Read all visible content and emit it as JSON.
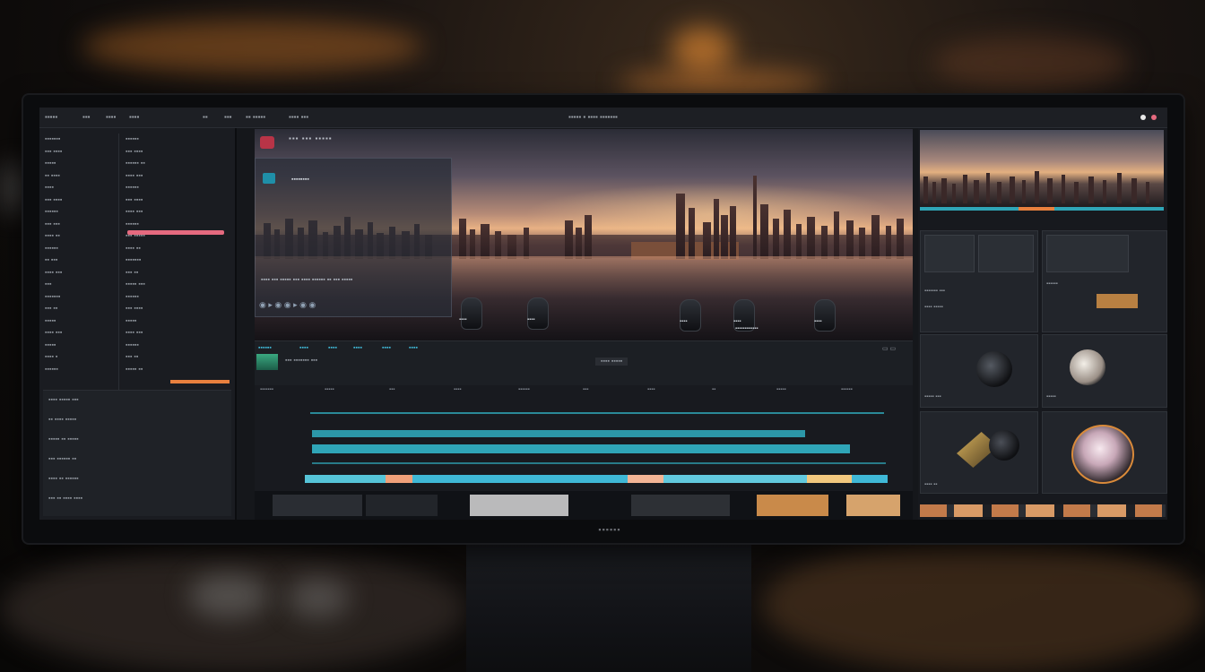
{
  "screen": {
    "menubar": {
      "left_items": [
        "▪▪▪▪▪",
        "▪▪▪",
        "▪▪▪▪",
        "▪▪▪▪",
        "▪▪",
        "▪▪▪",
        "▪▪ ▪▪▪▪▪",
        "▪▪▪▪ ▪▪▪"
      ],
      "center_text": "▪▪▪▪▪ ▪ ▪▪▪▪ ▪▪▪▪▪▪▪"
    },
    "brand": "▪▪▪▪▪▪"
  },
  "left_panel": {
    "col_a": [
      "▪▪▪▪▪▪▪",
      "▪▪▪ ▪▪▪▪",
      "▪▪▪▪▪",
      "▪▪ ▪▪▪▪",
      "▪▪▪▪",
      "▪▪▪ ▪▪▪▪",
      "▪▪▪▪▪▪",
      "▪▪▪ ▪▪▪",
      "▪▪▪▪ ▪▪",
      "▪▪▪▪▪▪",
      "▪▪ ▪▪▪",
      "▪▪▪▪ ▪▪▪",
      "▪▪▪",
      "▪▪▪▪▪▪▪",
      "▪▪▪ ▪▪",
      "▪▪▪▪▪",
      "▪▪▪▪ ▪▪▪",
      "▪▪▪▪▪",
      "▪▪▪▪ ▪",
      "▪▪▪▪▪▪"
    ],
    "col_b": [
      "▪▪▪▪▪▪",
      "▪▪▪ ▪▪▪▪",
      "▪▪▪▪▪▪ ▪▪",
      "▪▪▪▪ ▪▪▪",
      "▪▪▪▪▪▪",
      "▪▪▪ ▪▪▪▪",
      "▪▪▪▪ ▪▪▪",
      "▪▪▪▪▪▪",
      "▪▪▪ ▪▪▪▪▪",
      "▪▪▪▪ ▪▪",
      "▪▪▪▪▪▪▪",
      "▪▪▪ ▪▪",
      "▪▪▪▪▪ ▪▪▪",
      "▪▪▪▪▪▪",
      "▪▪▪ ▪▪▪▪",
      "▪▪▪▪▪",
      "▪▪▪▪ ▪▪▪",
      "▪▪▪▪▪▪",
      "▪▪▪ ▪▪",
      "▪▪▪▪▪ ▪▪"
    ],
    "lower_rows": [
      "▪▪▪▪ ▪▪▪▪▪ ▪▪▪",
      "▪▪ ▪▪▪▪ ▪▪▪▪▪",
      "▪▪▪▪▪ ▪▪ ▪▪▪▪▪",
      "▪▪▪ ▪▪▪▪▪▪ ▪▪",
      "▪▪▪▪ ▪▪ ▪▪▪▪▪▪",
      "▪▪▪ ▪▪ ▪▪▪▪ ▪▪▪▪"
    ]
  },
  "preview": {
    "title": "▪▪▪ ▪▪▪ ▪▪▪▪▪",
    "overlay_title": "▪▪▪▪▪▪▪▪",
    "overlay_desc": "▪▪▪▪ ▪▪▪ ▪▪▪▪▪ ▪▪▪ ▪▪▪▪ ▪▪▪▪▪▪ ▪▪ ▪▪▪ ▪▪▪▪▪",
    "knob_labels": [
      "▪▪▪▪",
      "▪▪▪▪",
      "▪▪▪▪",
      "▪▪▪▪",
      "▪▪▪▪"
    ],
    "right_caption": "▪▪▪▪▪▪▪▪▪▪▪▪"
  },
  "toolbar": {
    "labels": [
      "▪▪▪▪▪▪",
      "▪▪▪▪",
      "▪▪▪▪",
      "▪▪▪▪",
      "▪▪▪▪",
      "▪▪▪▪"
    ],
    "track_name": "▪▪▪ ▪▪▪▪▪▪▪ ▪▪▪",
    "right_field": "▪▪▪▪ ▪▪▪▪▪"
  },
  "timeline": {
    "ruler_labels": [
      "▪▪▪▪▪▪▪",
      "▪▪▪▪▪",
      "▪▪▪",
      "▪▪▪▪",
      "▪▪▪▪▪▪",
      "▪▪▪",
      "▪▪▪▪",
      "▪▪",
      "▪▪▪▪▪",
      "▪▪▪▪▪▪"
    ]
  },
  "right_panel": {
    "labels": [
      "▪▪▪▪▪▪▪ ▪▪▪",
      "▪▪▪▪ ▪▪▪▪▪",
      "▪▪▪▪▪▪",
      "▪▪▪▪▪ ▪▪▪",
      "▪▪▪▪▪",
      "▪▪▪▪ ▪▪"
    ]
  },
  "colors": {
    "accent_cyan": "#2fa5b7",
    "accent_pink": "#e56a7f",
    "accent_orange": "#e8803e",
    "panel_bg": "#1a1c21"
  }
}
